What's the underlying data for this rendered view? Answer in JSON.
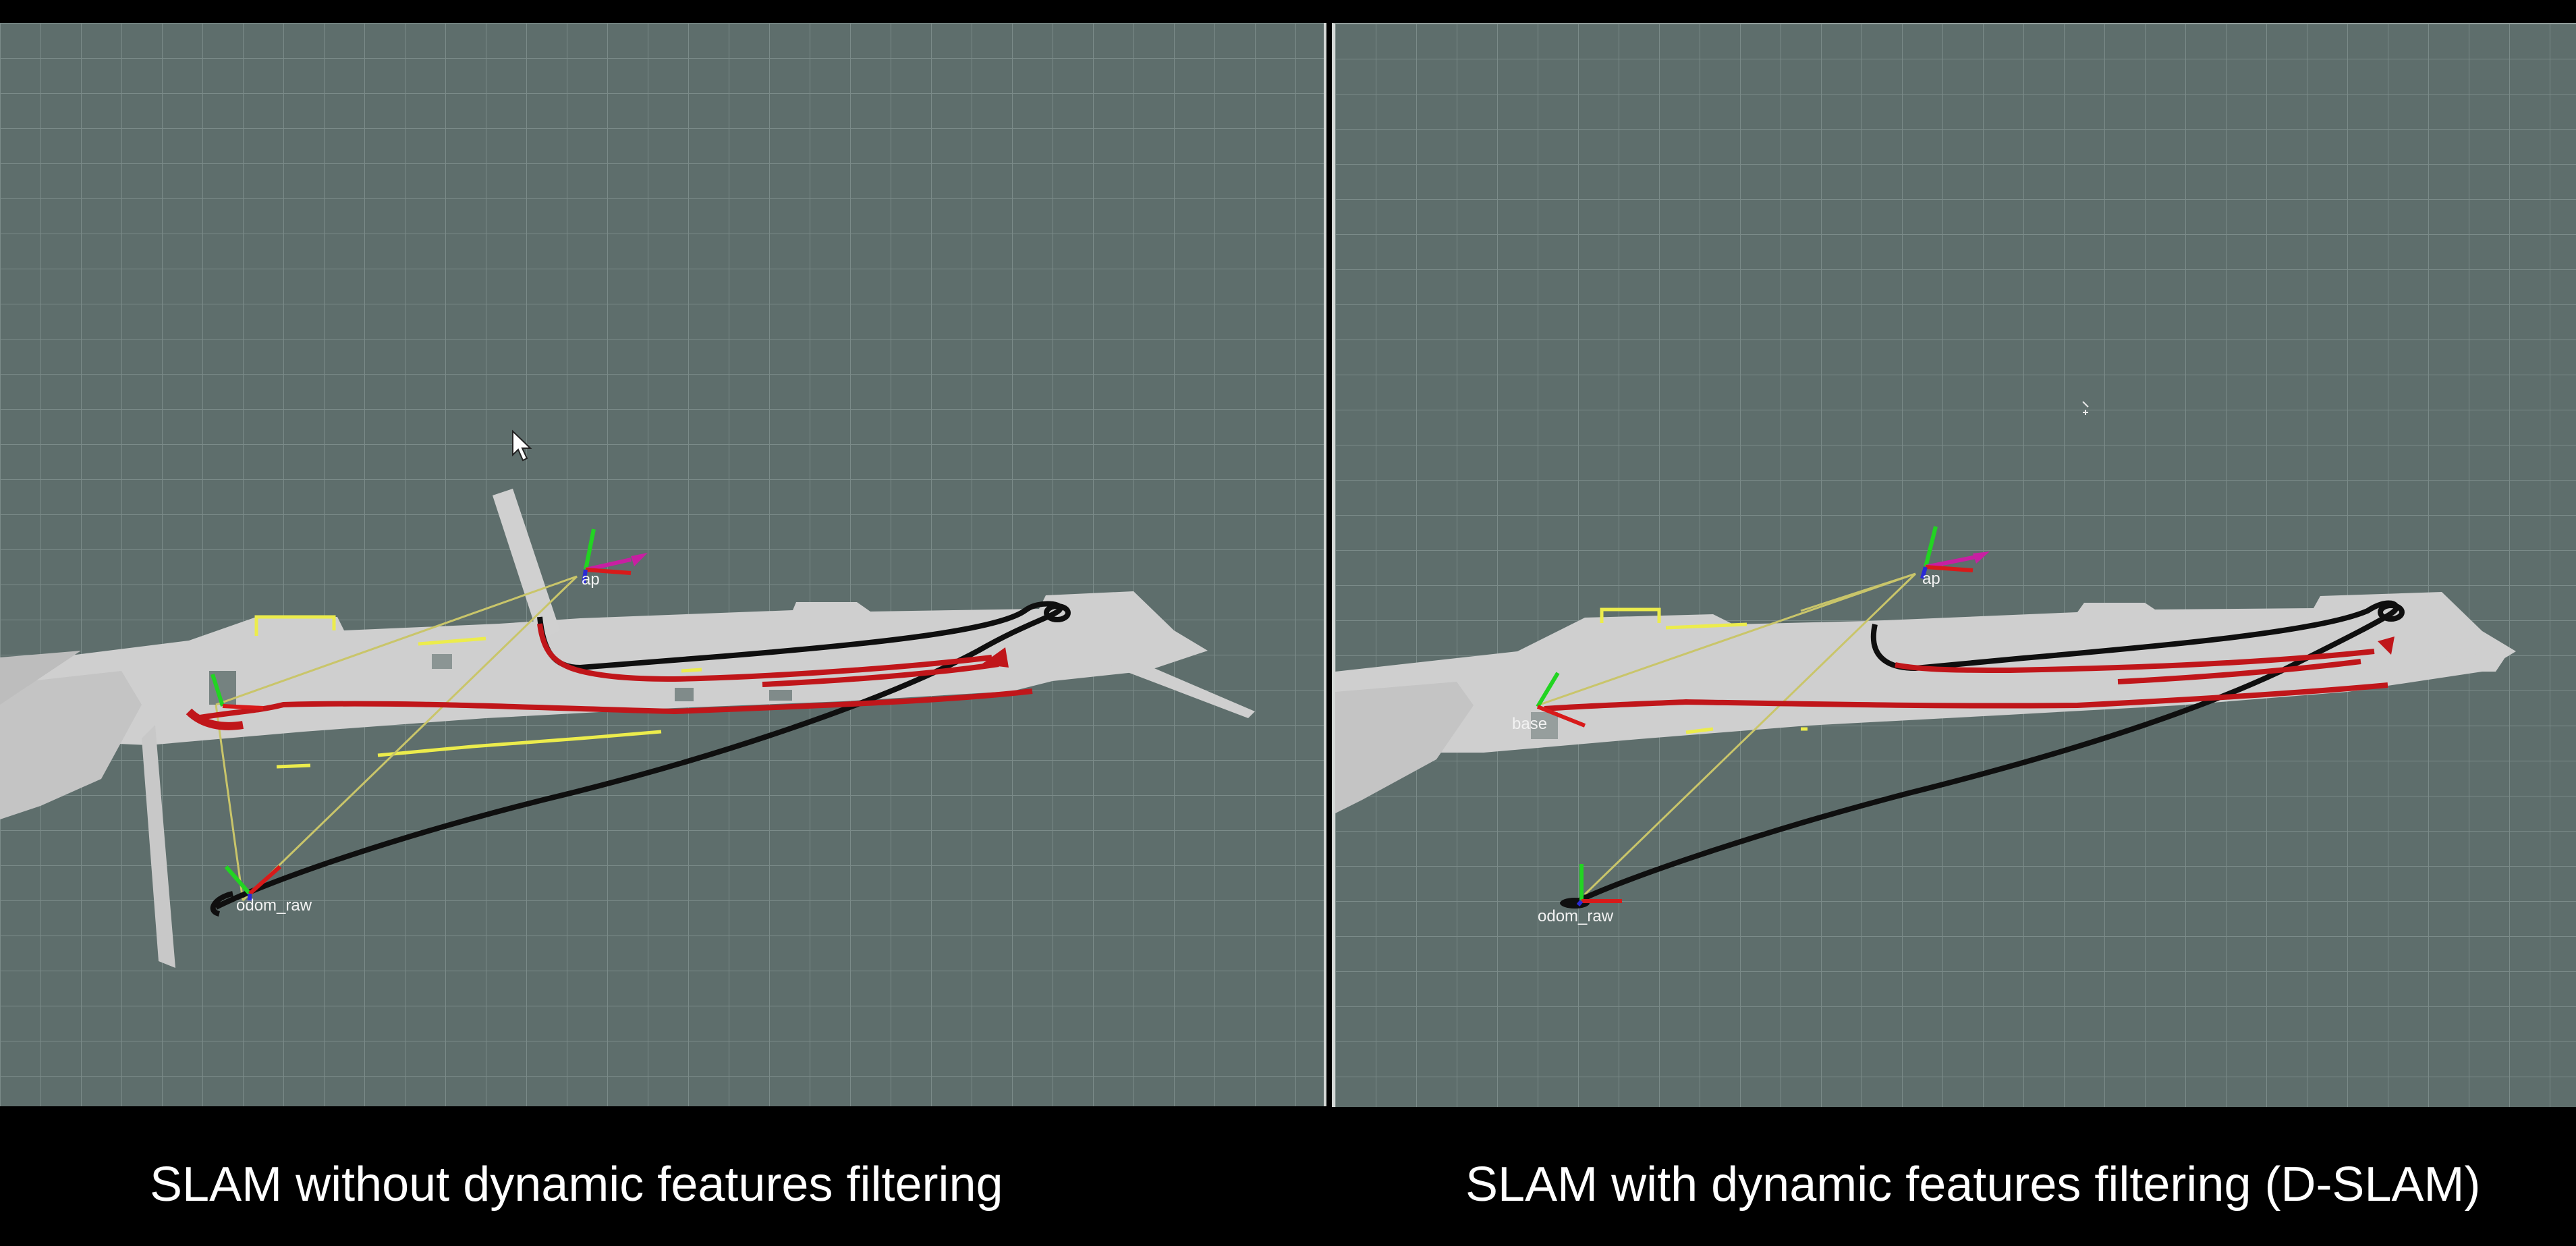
{
  "panels": [
    {
      "caption": "SLAM without dynamic features filtering",
      "frames": {
        "map": "ap",
        "odom": "odom_raw"
      }
    },
    {
      "caption": "SLAM with dynamic features filtering (D-SLAM)",
      "frames": {
        "map": "ap",
        "base": "base",
        "odom": "odom_raw"
      }
    }
  ],
  "colors": {
    "background": "#5e6e6c",
    "grid": "#7b8b89",
    "map_free_space": "#cfcfcf",
    "trajectory_ground_truth": "#c0161a",
    "trajectory_odometry": "#0f0f0f",
    "tf_links": "#c9c56a",
    "axis_x": "#d81a1a",
    "axis_y": "#22d422",
    "axis_z": "#2a2ad6",
    "map_axis_pointer": "#c81fa2",
    "scan_points": "#ecec4c",
    "panel_separator": "#d4d8d6",
    "caption_text": "#ffffff"
  },
  "icons": {
    "cursor": "mouse-pointer-icon",
    "crosshair": "crosshair-icon"
  }
}
